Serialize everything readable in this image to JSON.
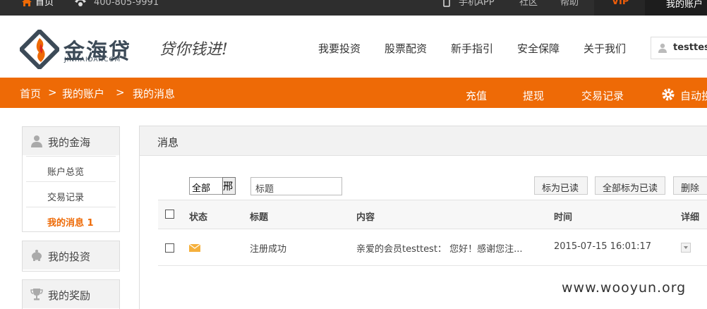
{
  "topbar": {
    "home": "首页",
    "phone": "400-805-9991",
    "app": "手机APP",
    "community": "社区",
    "help": "帮助",
    "vip": "VIP",
    "account": "我的账户"
  },
  "header": {
    "brand": "金海贷",
    "brand_sub": "JINHAIDAI.COM",
    "slogan": "贷你钱进!",
    "nav": [
      "我要投资",
      "股票配资",
      "新手指引",
      "安全保障",
      "关于我们"
    ],
    "username": "testtest"
  },
  "subbar": {
    "breadcrumb": [
      "首页",
      "我的账户",
      "我的消息"
    ],
    "separator": ">",
    "actions": [
      "充值",
      "提现",
      "交易记录",
      "自动投标"
    ]
  },
  "sidebar": {
    "sections": [
      {
        "title": "我的金海",
        "items": [
          "账户总览",
          "交易记录",
          "我的消息 1"
        ],
        "active": "我的消息 1"
      },
      {
        "title": "我的投资"
      },
      {
        "title": "我的奖励"
      }
    ]
  },
  "main": {
    "title": "消息",
    "filter_select": "全部",
    "filter_select_btn": "郉",
    "title_input": "标题",
    "buttons": [
      "标为已读",
      "全部标为已读",
      "删除"
    ],
    "columns": [
      "状态",
      "标题",
      "内容",
      "时间",
      "详细"
    ],
    "rows": [
      {
        "title": "注册成功",
        "content": "亲爱的会员testtest： 您好！感谢您注...",
        "time": "2015-07-15 16:01:17"
      }
    ]
  },
  "watermark": "www.wooyun.org",
  "colors": {
    "accent": "#ee6a06",
    "topbar": "#2e2e2e",
    "active": "#ee6a06"
  }
}
